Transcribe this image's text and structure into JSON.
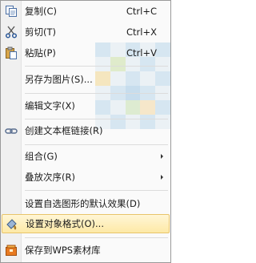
{
  "menu": {
    "items": [
      {
        "label": "复制(C)",
        "shortcut": "Ctrl+C",
        "icon": "copy-icon"
      },
      {
        "label": "剪切(T)",
        "shortcut": "Ctrl+X",
        "icon": "scissors-icon"
      },
      {
        "label": "粘贴(P)",
        "shortcut": "Ctrl+V",
        "icon": "paste-icon"
      },
      {
        "label": "另存为图片(S)...",
        "shortcut": "",
        "icon": ""
      },
      {
        "label": "编辑文字(X)",
        "shortcut": "",
        "icon": ""
      },
      {
        "label": "创建文本框链接(R)",
        "shortcut": "",
        "icon": "link-icon"
      },
      {
        "label": "组合(G)",
        "shortcut": "",
        "icon": ""
      },
      {
        "label": "叠放次序(R)",
        "shortcut": "",
        "icon": ""
      },
      {
        "label": "设置自选图形的默认效果(D)",
        "shortcut": "",
        "icon": ""
      },
      {
        "label": "设置对象格式(O)...",
        "shortcut": "",
        "icon": "format-object-icon"
      },
      {
        "label": "保存到WPS素材库",
        "shortcut": "",
        "icon": "material-library-icon"
      }
    ]
  },
  "colors": {
    "highlight_fill": "#fde9a6",
    "highlight_border": "#e8c46a",
    "gutter": "#f0f0f0"
  }
}
